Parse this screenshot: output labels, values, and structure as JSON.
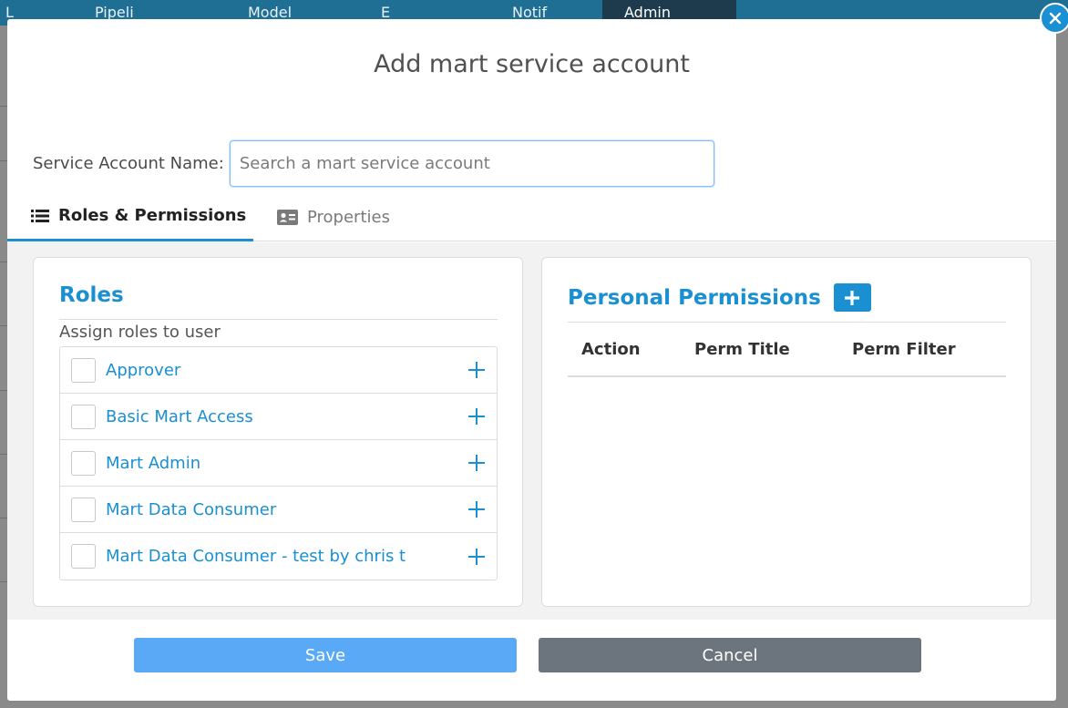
{
  "background": {
    "nav_tabs": [
      "L",
      "Pipeli",
      "Model",
      "E",
      "Notif",
      "Admin"
    ]
  },
  "modal": {
    "title": "Add mart service account",
    "service_account": {
      "label": "Service Account Name:",
      "placeholder": "Search a mart service account",
      "value": ""
    },
    "tabs": [
      {
        "label": "Roles & Permissions",
        "icon": "list-icon",
        "active": true
      },
      {
        "label": "Properties",
        "icon": "id-card-icon",
        "active": false
      }
    ],
    "roles": {
      "title": "Roles",
      "subtitle": "Assign roles to user",
      "items": [
        {
          "label": "Approver",
          "checked": false
        },
        {
          "label": "Basic Mart Access",
          "checked": false
        },
        {
          "label": "Mart Admin",
          "checked": false
        },
        {
          "label": "Mart Data Consumer",
          "checked": false
        },
        {
          "label": "Mart Data Consumer - test by chris t",
          "checked": false
        }
      ]
    },
    "permissions": {
      "title": "Personal Permissions",
      "columns": [
        "Action",
        "Perm Title",
        "Perm Filter"
      ],
      "rows": []
    },
    "buttons": {
      "save": "Save",
      "cancel": "Cancel"
    }
  },
  "colors": {
    "accent": "#1a8fd1",
    "save_button": "#5aa9f7",
    "cancel_button": "#6c747d",
    "topbar": "#1f6f95"
  }
}
